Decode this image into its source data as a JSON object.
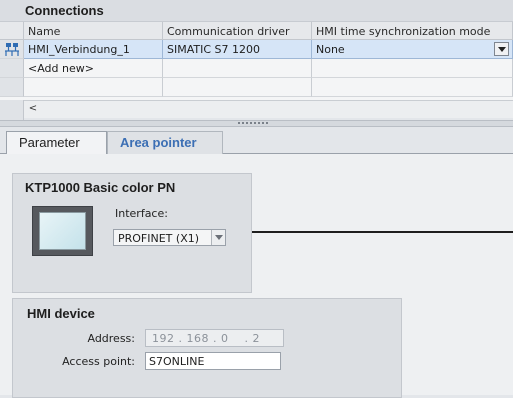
{
  "connections": {
    "title": "Connections",
    "columns": [
      "Name",
      "Communication driver",
      "HMI time synchronization mode"
    ],
    "rows": [
      {
        "name": "HMI_Verbindung_1",
        "driver": "SIMATIC S7 1200",
        "sync_mode": "None"
      },
      {
        "name": "<Add new>",
        "driver": "",
        "sync_mode": ""
      }
    ],
    "scroll_left": "<"
  },
  "tabs": {
    "parameter": "Parameter",
    "area_pointer": "Area pointer"
  },
  "device": {
    "title": "KTP1000 Basic color PN",
    "interface_label": "Interface:",
    "interface_value": "PROFINET (X1)"
  },
  "hmi_device": {
    "title": "HMI device",
    "address_label": "Address:",
    "address_value": "192 . 168 . 0    . 2",
    "access_point_label": "Access point:",
    "access_point_value": "S7ONLINE"
  },
  "colors": {
    "selected_row": "#d6e5f7",
    "tab_inactive_text": "#3c6fb4",
    "panel_bg": "#dcdfe3"
  }
}
